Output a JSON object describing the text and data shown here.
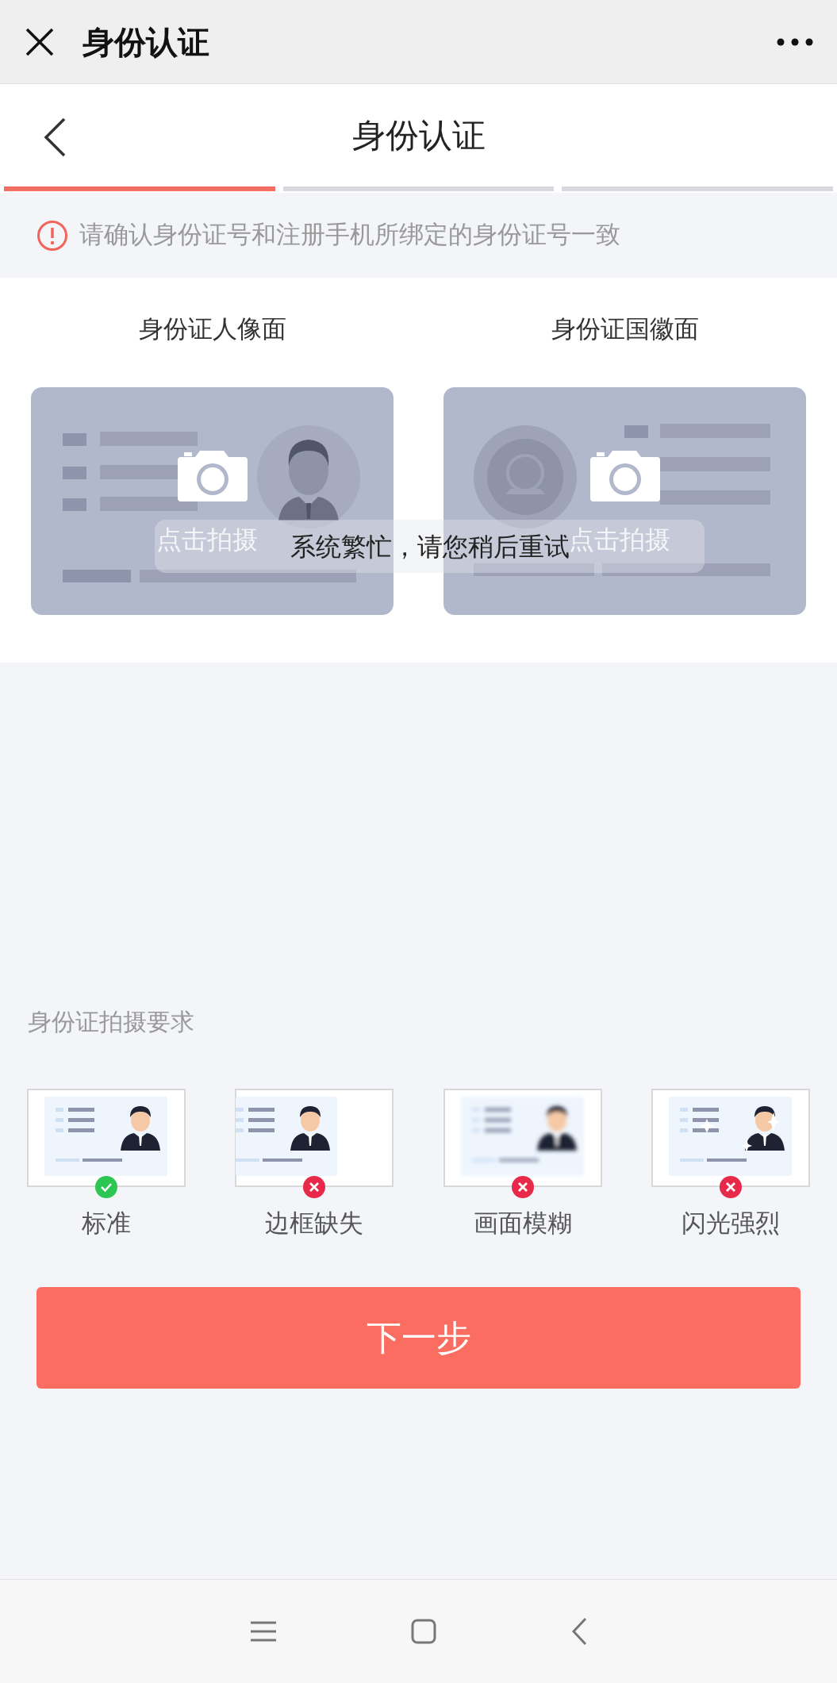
{
  "top_bar": {
    "title": "身份认证"
  },
  "header": {
    "title": "身份认证"
  },
  "progress": [
    {
      "selected": true
    },
    {
      "selected": false
    },
    {
      "selected": false
    }
  ],
  "notice": "请确认身份证号和注册手机所绑定的身份证号一致",
  "cards": [
    {
      "label": "身份证人像面",
      "kind": "portrait",
      "prompt": "点击拍摄"
    },
    {
      "label": "身份证国徽面",
      "kind": "emblem",
      "prompt": "点击拍摄"
    }
  ],
  "toast": "系统繁忙，请您稍后重试",
  "requirements": {
    "title": "身份证拍摄要求",
    "items": [
      {
        "label": "标准",
        "kind": "standard",
        "ok": true
      },
      {
        "label": "边框缺失",
        "kind": "no-border",
        "ok": false
      },
      {
        "label": "画面模糊",
        "kind": "blurry",
        "ok": false
      },
      {
        "label": "闪光强烈",
        "kind": "glare",
        "ok": false
      }
    ]
  },
  "next_button": "下一步"
}
